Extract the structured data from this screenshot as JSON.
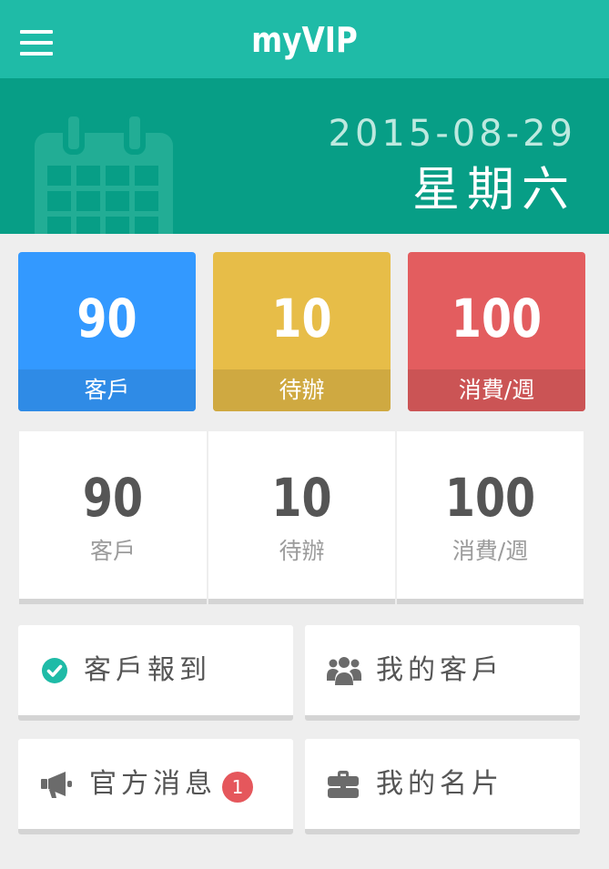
{
  "header": {
    "title": "myVIP",
    "menu_icon": "hamburger-icon"
  },
  "banner": {
    "date": "2015-08-29",
    "weekday": "星期六",
    "icon": "calendar-icon"
  },
  "tiles": [
    {
      "value": "90",
      "label": "客戶",
      "color": "#3399ff",
      "strip_color": "#2f8be6"
    },
    {
      "value": "10",
      "label": "待辦",
      "color": "#e7bd48",
      "strip_color": "#cfa941"
    },
    {
      "value": "100",
      "label": "消費/週",
      "color": "#e35d5f",
      "strip_color": "#cb5455"
    }
  ],
  "stats": [
    {
      "value": "90",
      "label": "客戶"
    },
    {
      "value": "10",
      "label": "待辦"
    },
    {
      "value": "100",
      "label": "消費/週"
    }
  ],
  "actions": [
    {
      "label": "客戶報到",
      "icon": "check-circle-icon"
    },
    {
      "label": "我的客戶",
      "icon": "users-icon"
    },
    {
      "label": "官方消息",
      "icon": "megaphone-icon",
      "badge": "1"
    },
    {
      "label": "我的名片",
      "icon": "briefcase-icon"
    }
  ],
  "colors": {
    "topbar": "#1fbba7",
    "banner": "#079e86",
    "accent_check": "#1fbba7",
    "badge": "#e5575c"
  }
}
